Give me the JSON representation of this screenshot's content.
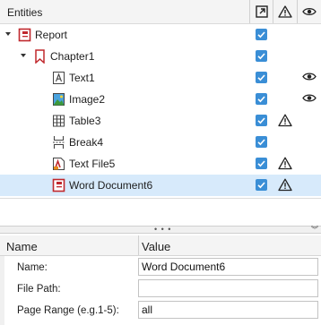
{
  "entities": {
    "title": "Entities",
    "columns": {
      "export_icon": "external-link-icon",
      "warning_icon": "warning-icon",
      "visibility_icon": "eye-icon"
    },
    "rows": [
      {
        "label": "Report",
        "icon": "report-icon",
        "level": 0,
        "expanded": true,
        "checked": true,
        "warning": false,
        "visible": false,
        "selected": false
      },
      {
        "label": "Chapter1",
        "icon": "chapter-icon",
        "level": 1,
        "expanded": true,
        "checked": true,
        "warning": false,
        "visible": false,
        "selected": false
      },
      {
        "label": "Text1",
        "icon": "text-icon",
        "level": 2,
        "checked": true,
        "warning": false,
        "visible": true,
        "selected": false
      },
      {
        "label": "Image2",
        "icon": "image-icon",
        "level": 2,
        "checked": true,
        "warning": false,
        "visible": true,
        "selected": false
      },
      {
        "label": "Table3",
        "icon": "table-icon",
        "level": 2,
        "checked": true,
        "warning": true,
        "visible": false,
        "selected": false
      },
      {
        "label": "Break4",
        "icon": "page-break-icon",
        "level": 2,
        "checked": true,
        "warning": false,
        "visible": false,
        "selected": false
      },
      {
        "label": "Text File5",
        "icon": "text-file-icon",
        "level": 2,
        "checked": true,
        "warning": true,
        "visible": false,
        "selected": false
      },
      {
        "label": "Word Document6",
        "icon": "word-document-icon",
        "level": 2,
        "checked": true,
        "warning": true,
        "visible": false,
        "selected": true
      }
    ]
  },
  "splitter": {
    "grip": "• • •",
    "collapse": "︾"
  },
  "properties": {
    "header_name": "Name",
    "header_value": "Value",
    "rows": [
      {
        "label": "Name:",
        "value": "Word Document6"
      },
      {
        "label": "File Path:",
        "value": ""
      },
      {
        "label": "Page Range (e.g.1-5):",
        "value": "all"
      }
    ]
  },
  "colors": {
    "accent": "#3a8ed6",
    "selection": "#d7eafb",
    "report_red": "#c0282d"
  }
}
